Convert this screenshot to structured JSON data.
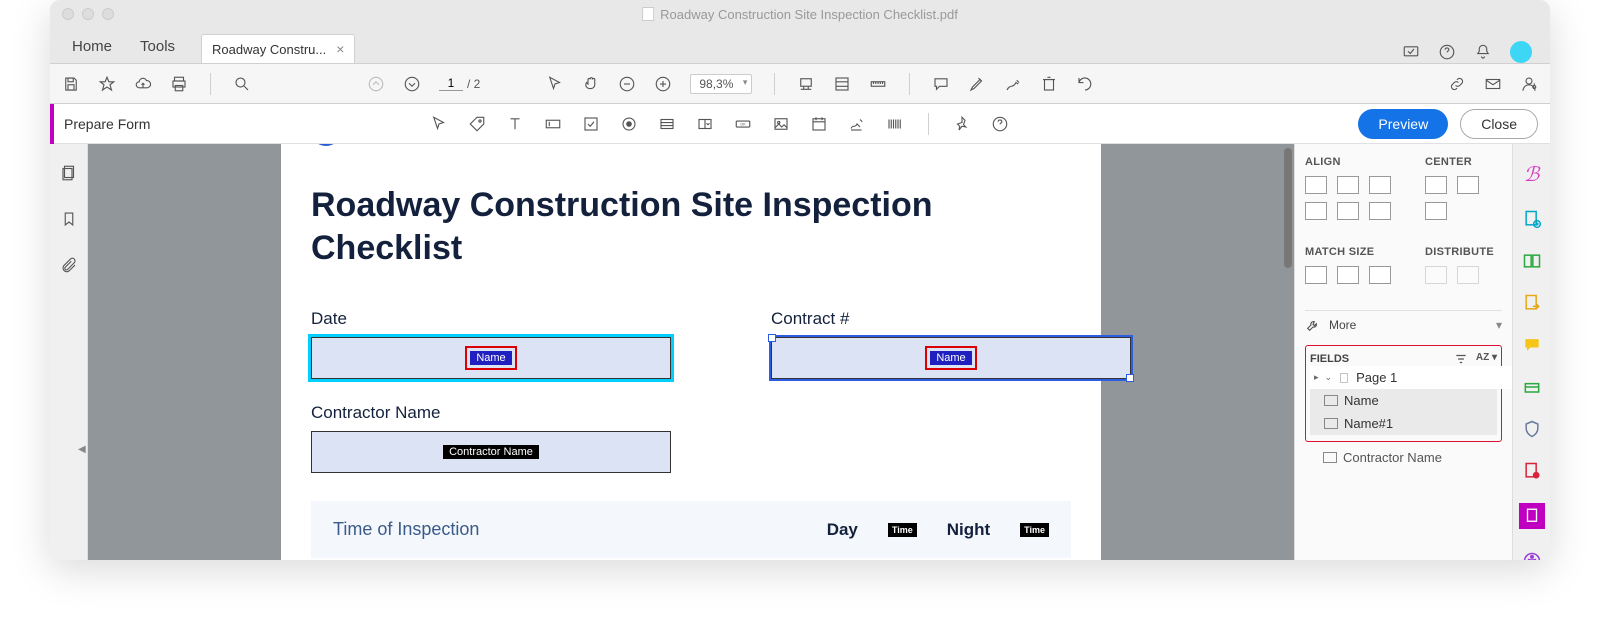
{
  "window": {
    "title": "Roadway Construction Site Inspection Checklist.pdf"
  },
  "tabs": {
    "home": "Home",
    "tools": "Tools",
    "doc": "Roadway Constru...",
    "close_x": "×"
  },
  "toolbar": {
    "page_current": "1",
    "page_total": "/  2",
    "zoom": "98,3%"
  },
  "formbar": {
    "mode": "Prepare Form",
    "preview": "Preview",
    "close": "Close"
  },
  "document": {
    "title": "Roadway Construction Site Inspection Checklist",
    "date_label": "Date",
    "contract_label": "Contract #",
    "contractor_label": "Contractor Name",
    "field_name_tag": "Name",
    "contractor_tag": "Contractor Name",
    "section_time": "Time of Inspection",
    "day": "Day",
    "night": "Night",
    "time_box": "Time"
  },
  "panel": {
    "align": "ALIGN",
    "center": "CENTER",
    "match": "MATCH SIZE",
    "distribute": "DISTRIBUTE",
    "more": "More",
    "fields": "FIELDS",
    "page1": "Page 1",
    "f1": "Name",
    "f2": "Name#1",
    "f3": "Contractor Name",
    "sort_glyph": "A͏Z ▾"
  }
}
